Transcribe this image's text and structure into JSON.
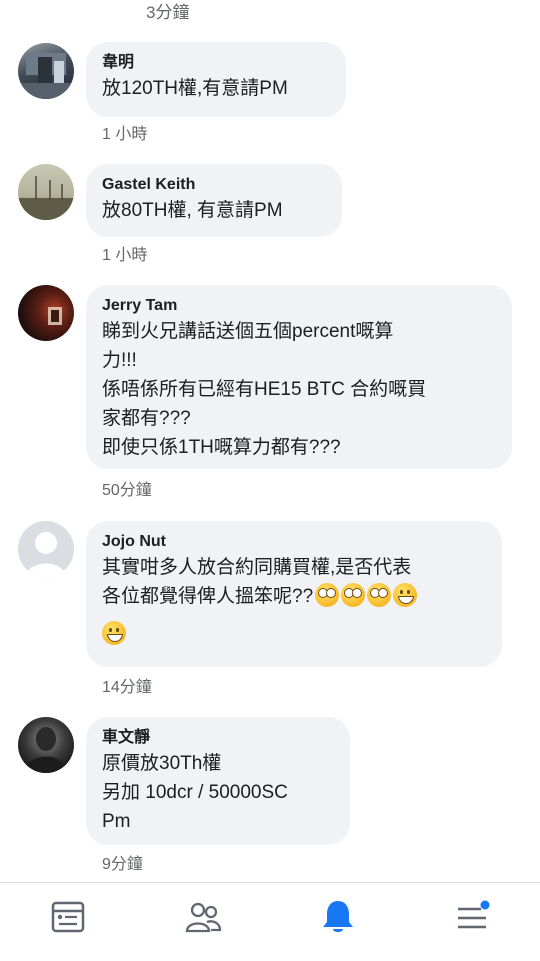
{
  "top_comment_time": "3分鐘",
  "comments": [
    {
      "author": "韋明",
      "text": "放120TH權,有意請PM",
      "time": "1 小時"
    },
    {
      "author": "Gastel Keith",
      "text": "放80TH權, 有意請PM",
      "time": "1 小時"
    },
    {
      "author": "Jerry Tam",
      "text": "睇到火兄講話送個五個percent嘅算\n力!!!\n係唔係所有已經有HE15 BTC 合約嘅買\n家都有???\n即使只係1TH嘅算力都有???",
      "time": "50分鐘"
    },
    {
      "author": "Jojo Nut",
      "text": "其實咁多人放合約同購買權,是否代表\n各位都覺得俾人搵笨呢??",
      "emojis": [
        "face-with-rolling-eyes",
        "face-with-rolling-eyes",
        "face-with-rolling-eyes",
        "grinning-face",
        "grinning-face"
      ],
      "time": "14分鐘"
    },
    {
      "author": "車文靜",
      "text": "原價放30Th權\n另加 10dcr / 50000SC\nPm",
      "time": "9分鐘"
    }
  ],
  "nav": {
    "items": [
      "news-feed-icon",
      "friends-icon",
      "notifications-icon",
      "menu-icon"
    ],
    "active_color": "#1877f2",
    "inactive_color": "#606770"
  }
}
